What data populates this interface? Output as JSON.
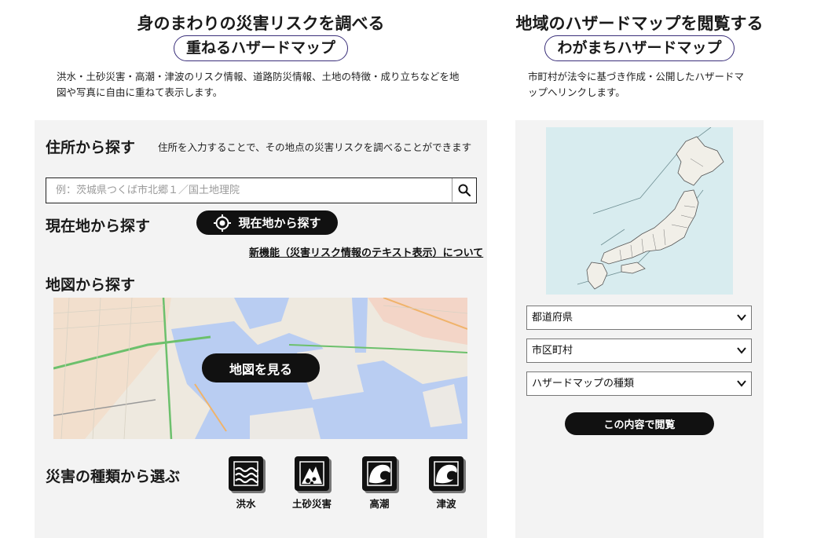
{
  "left_header": {
    "subtitle": "身のまわりの災害リスクを調べる",
    "title": "重ねるハザードマップ",
    "description_line1": "洪水・土砂災害・高潮・津波のリスク情報、道路防災情報、土地の特徴・成り立ちなどを地",
    "description_line2": "図や写真に自由に重ねて表示します。"
  },
  "right_header": {
    "subtitle": "地域のハザードマップを閲覧する",
    "title": "わがまちハザードマップ",
    "description_line1": "市町村が法令に基づき作成・公開したハザードマ",
    "description_line2": "ップへリンクします。"
  },
  "address_search": {
    "heading": "住所から探す",
    "note": "住所を入力することで、その地点の災害リスクを調べることができます",
    "placeholder": "例：茨城県つくば市北郷１／国土地理院",
    "icon": "search-icon"
  },
  "current_location": {
    "heading": "現在地から探す",
    "button_label": "現在地から探す",
    "icon": "crosshair-icon"
  },
  "new_feature_link": "新機能（災害リスク情報のテキスト表示）について",
  "map_search": {
    "heading": "地図から探す",
    "button_label": "地図を見る"
  },
  "hazard_type": {
    "heading": "災害の種類から選ぶ",
    "items": [
      {
        "label": "洪水",
        "icon": "flood-icon"
      },
      {
        "label": "土砂災害",
        "icon": "landslide-icon"
      },
      {
        "label": "高潮",
        "icon": "storm-surge-icon"
      },
      {
        "label": "津波",
        "icon": "tsunami-icon"
      }
    ]
  },
  "wagamachi": {
    "selects": [
      "都道府県",
      "市区町村",
      "ハザードマップの種類"
    ],
    "view_button": "この内容で閲覧"
  },
  "colors": {
    "panel_bg": "#f3f3f3",
    "button_bg": "#111111",
    "pill_border": "#3a2f7a",
    "japan_sea": "#d8ecef"
  }
}
